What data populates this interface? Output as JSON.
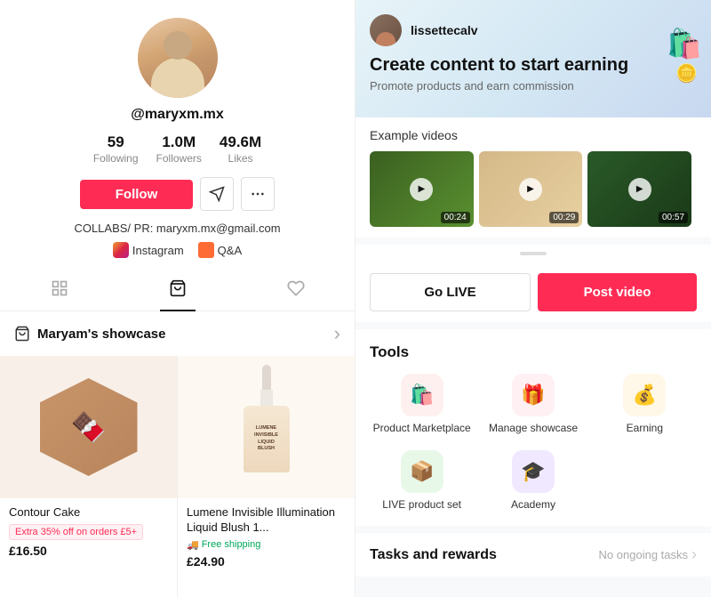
{
  "left": {
    "username": "@maryxm.mx",
    "stats": {
      "following": "59",
      "following_label": "Following",
      "followers": "1.0M",
      "followers_label": "Followers",
      "likes": "49.6M",
      "likes_label": "Likes"
    },
    "follow_btn": "Follow",
    "bio": "COLLABS/ PR: maryxm.mx@gmail.com",
    "instagram_label": "Instagram",
    "qa_label": "Q&A",
    "showcase_title": "Maryam's showcase",
    "products": [
      {
        "name": "Contour Cake",
        "badge": "Extra 35% off on orders £5+",
        "price": "£16.50",
        "free_shipping": "",
        "type": "contour"
      },
      {
        "name": "Lumene Invisible Illumination Liquid Blush 1...",
        "badge": "",
        "price": "£24.90",
        "free_shipping": "Free shipping",
        "type": "lumene"
      }
    ]
  },
  "right": {
    "creator_name": "lissettecalv",
    "earn_title": "Create content to start earning",
    "earn_subtitle": "Promote products and earn commission",
    "example_videos_label": "Example videos",
    "videos": [
      {
        "duration": "00:24"
      },
      {
        "duration": "00:29"
      },
      {
        "duration": "00:57"
      }
    ],
    "go_live_btn": "Go LIVE",
    "post_video_btn": "Post video",
    "tools_title": "Tools",
    "tools": [
      {
        "label": "Product Marketplace",
        "icon": "🛍️",
        "color": "red"
      },
      {
        "label": "Manage showcase",
        "icon": "🎁",
        "color": "pink"
      },
      {
        "label": "Earning",
        "icon": "💰",
        "color": "yellow"
      },
      {
        "label": "LIVE product set",
        "icon": "📦",
        "color": "green"
      },
      {
        "label": "Academy",
        "icon": "🎓",
        "color": "purple"
      }
    ],
    "tasks_title": "Tasks and rewards",
    "tasks_status": "No ongoing tasks"
  },
  "icons": {
    "bag": "🛍️",
    "coin": "🪙",
    "chevron_right": "›",
    "shopping_bag_tab": "🛍",
    "grid_tab": "⊞",
    "heart_tab": "♡",
    "insta": "📷",
    "qa": "Q&A"
  }
}
